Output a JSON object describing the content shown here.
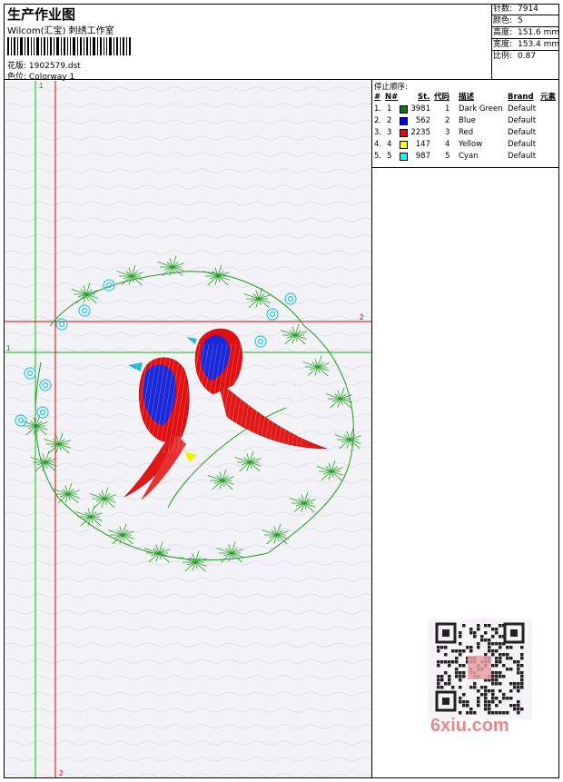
{
  "header": {
    "title": "生产作业图",
    "company": "Wilcom(汇宝) 刺绣工作室",
    "file_label": "花版:",
    "file_value": "1902579.dst",
    "colorway_label": "色位:",
    "colorway_value": "Colorway 1"
  },
  "stats": [
    {
      "label": "针数:",
      "value": "7914"
    },
    {
      "label": "颜色:",
      "value": "5"
    },
    {
      "label": "高度:",
      "value": "151.6 mm"
    },
    {
      "label": "宽度:",
      "value": "153.4 mm"
    },
    {
      "label": "比例:",
      "value": "0.87"
    }
  ],
  "stop_sequence": {
    "title": "停止顺序:",
    "headers": {
      "num": "#",
      "n": "N#",
      "st": "St.",
      "code": "代码",
      "desc": "描述",
      "brand": "Brand",
      "elem": "元素"
    },
    "rows": [
      {
        "num": "1.",
        "n": "1",
        "color": "#008000",
        "st": "3981",
        "code": "1",
        "desc": "Dark Green",
        "brand": "Default"
      },
      {
        "num": "2.",
        "n": "2",
        "color": "#0000ff",
        "st": "562",
        "code": "2",
        "desc": "Blue",
        "brand": "Default"
      },
      {
        "num": "3.",
        "n": "3",
        "color": "#ff0000",
        "st": "2235",
        "code": "3",
        "desc": "Red",
        "brand": "Default"
      },
      {
        "num": "4.",
        "n": "4",
        "color": "#ffff00",
        "st": "147",
        "code": "4",
        "desc": "Yellow",
        "brand": "Default"
      },
      {
        "num": "5.",
        "n": "5",
        "color": "#00ffff",
        "st": "987",
        "code": "5",
        "desc": "Cyan",
        "brand": "Default"
      }
    ]
  },
  "guides": {
    "green_label": "1",
    "red_label": "2"
  },
  "watermark": {
    "text": "6xiu.com"
  }
}
